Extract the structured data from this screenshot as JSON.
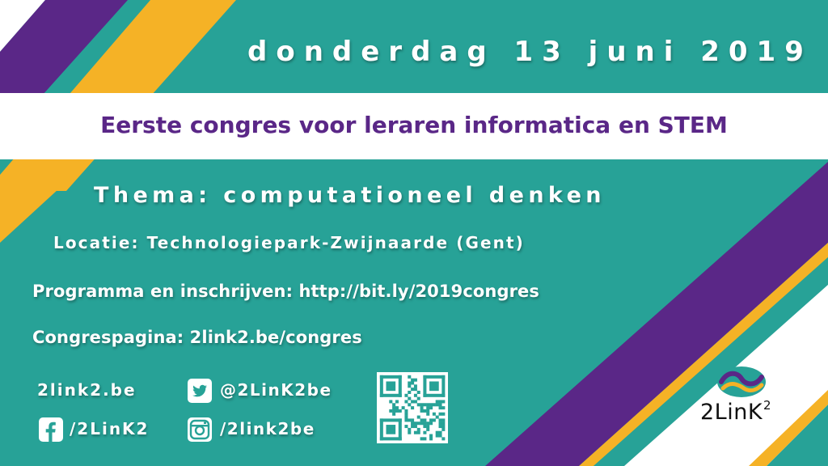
{
  "event": {
    "date": "donderdag 13 juni 2019",
    "title": "Eerste congres voor leraren informatica en STEM",
    "theme": "Thema: computationeel denken",
    "location": "Locatie: Technologiepark-Zwijnaarde (Gent)",
    "program": "Programma en inschrijven: http://bit.ly/2019congres",
    "congress_page": "Congrespagina: 2link2.be/congres"
  },
  "social": {
    "website": "2link2.be",
    "twitter": "@2LinK2be",
    "facebook": "/2LinK2",
    "instagram": "/2link2be",
    "twitter_icon": "twitter-icon",
    "facebook_icon": "facebook-icon",
    "instagram_icon": "instagram-icon"
  },
  "logo": {
    "name": "2LinK",
    "superscript": "2"
  },
  "colors": {
    "teal": "#27a297",
    "purple": "#5a2787",
    "orange": "#f5b226",
    "white": "#ffffff"
  }
}
